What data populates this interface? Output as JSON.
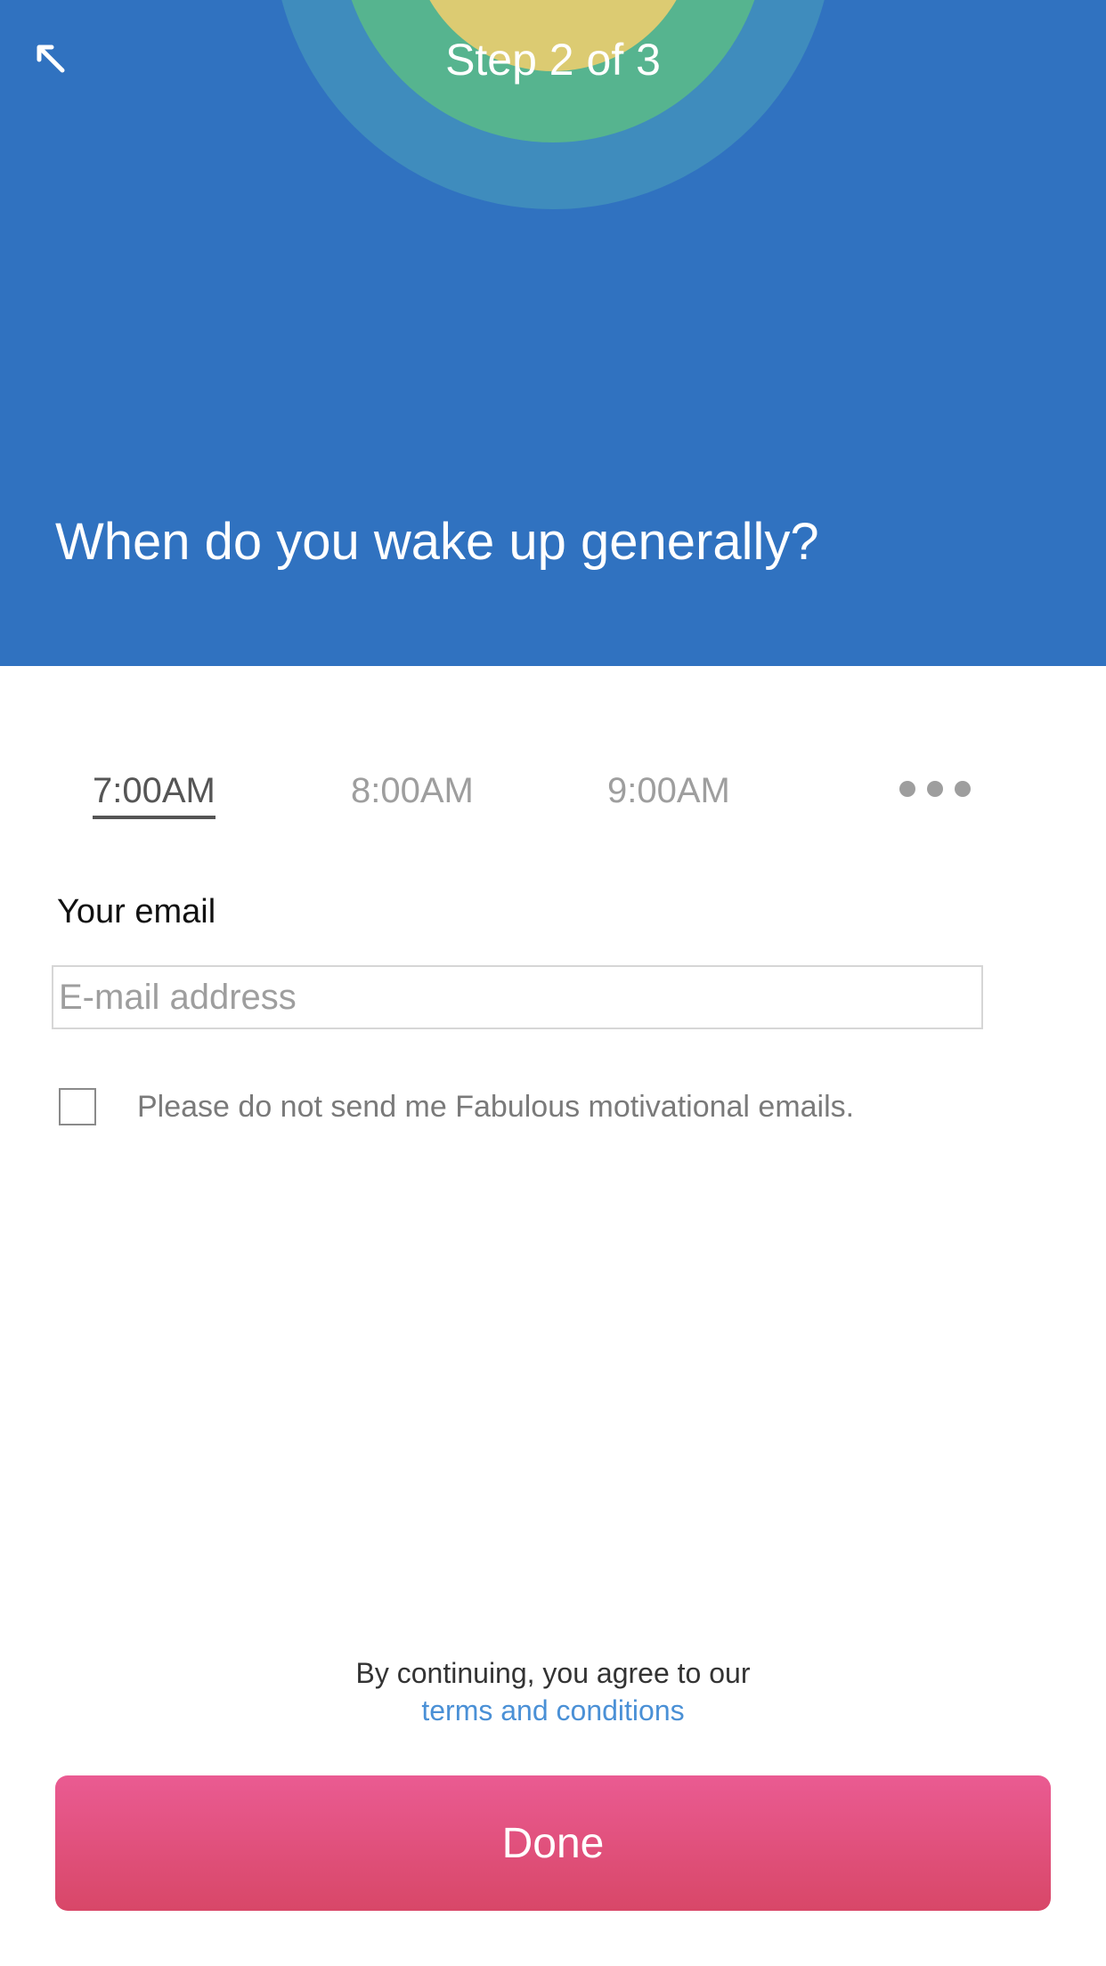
{
  "header": {
    "step_label": "Step 2 of 3",
    "question": "When do you wake up generally?",
    "back_icon": "back-arrow-icon",
    "colors": {
      "background": "#3072c0",
      "art_outer": "#3f8cbd",
      "art_middle": "#56b48f",
      "art_inner": "#dccb72"
    }
  },
  "wake_times": {
    "options": [
      "7:00AM",
      "8:00AM",
      "9:00AM"
    ],
    "selected": "7:00AM",
    "more_icon": "more-dots-icon"
  },
  "email": {
    "label": "Your email",
    "placeholder": "E-mail address",
    "value": ""
  },
  "opt_out": {
    "label": "Please do not send me Fabulous motivational emails.",
    "checked": false
  },
  "terms": {
    "prefix": "By continuing, you agree to our",
    "link": "terms and conditions"
  },
  "done_button": {
    "label": "Done",
    "color": "#e0517c"
  }
}
